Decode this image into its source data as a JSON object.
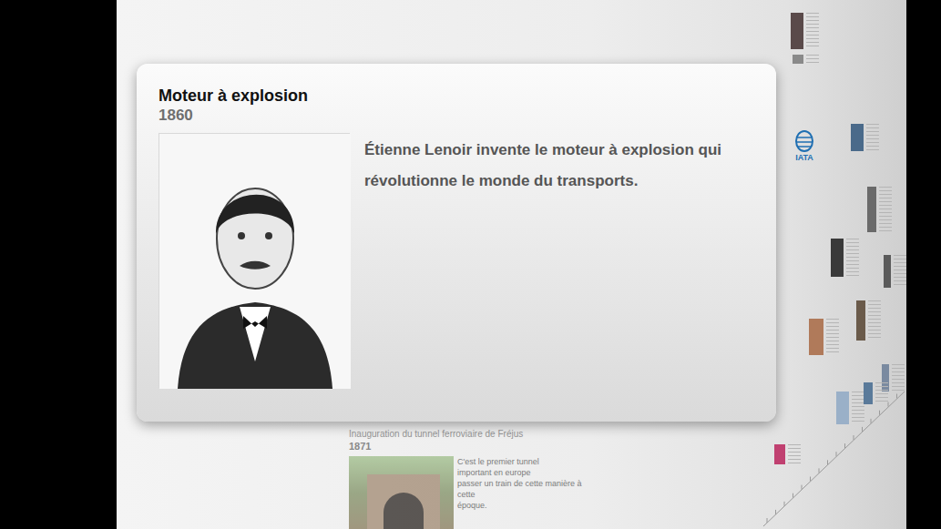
{
  "event": {
    "title": "Moteur à explosion",
    "year": "1860",
    "description": "Étienne Lenoir invente le moteur à explosion qui révolutionne le monde du transports."
  },
  "background_event": {
    "title": "Inauguration du tunnel ferroviaire de Fréjus",
    "year": "1871",
    "lines": [
      "C'est le premier tunnel",
      "important en europe",
      "passer un train de cette manière à cette",
      "époque."
    ]
  },
  "timeline_logos": [
    {
      "label": "IATA"
    }
  ]
}
